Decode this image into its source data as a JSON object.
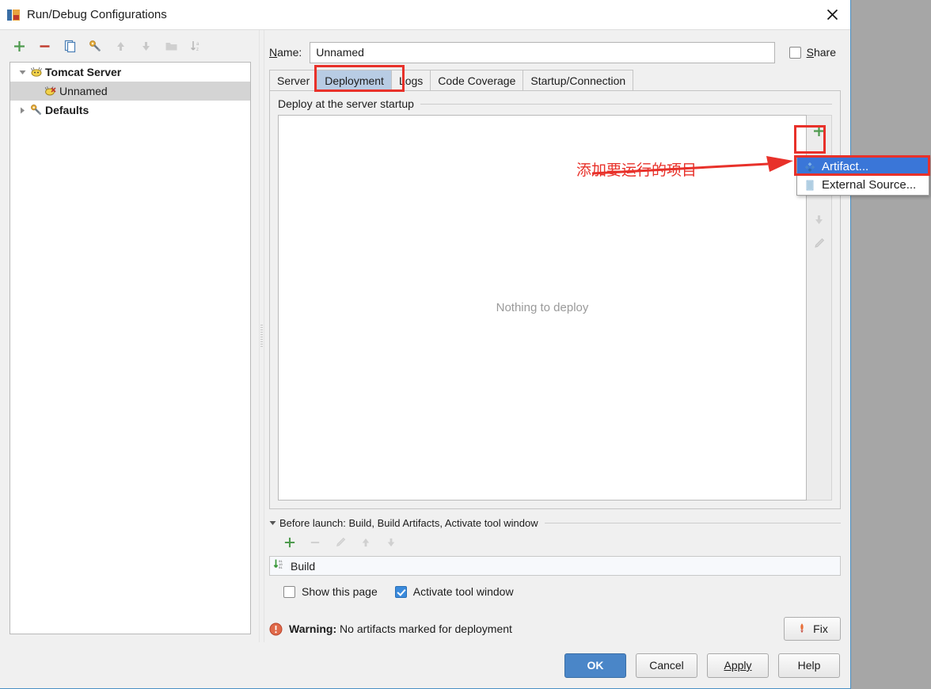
{
  "window": {
    "title": "Run/Debug Configurations",
    "app_icon": "intellij-idea-icon",
    "close_icon": "close-icon"
  },
  "left_toolbar": {
    "buttons": [
      {
        "name": "add-configuration-button",
        "icon": "plus-icon",
        "enabled": true
      },
      {
        "name": "remove-configuration-button",
        "icon": "minus-icon",
        "enabled": true
      },
      {
        "name": "copy-configuration-button",
        "icon": "copy-icon",
        "enabled": true
      },
      {
        "name": "edit-defaults-button",
        "icon": "wrench-icon",
        "enabled": true
      },
      {
        "name": "move-up-button",
        "icon": "arrow-up-icon",
        "enabled": false
      },
      {
        "name": "move-down-button",
        "icon": "arrow-down-icon",
        "enabled": false
      },
      {
        "name": "new-folder-button",
        "icon": "folder-icon",
        "enabled": false
      },
      {
        "name": "sort-alphabetically-button",
        "icon": "sort-az-icon",
        "enabled": false
      }
    ]
  },
  "tree": {
    "items": [
      {
        "label": "Tomcat Server",
        "icon": "tomcat-icon",
        "twisty": "expanded",
        "bold": true,
        "selected": false,
        "child": false
      },
      {
        "label": "Unnamed",
        "icon": "tomcat-run-icon",
        "twisty": "none",
        "bold": false,
        "selected": true,
        "child": true
      },
      {
        "label": "Defaults",
        "icon": "wrench-icon",
        "twisty": "collapsed",
        "bold": true,
        "selected": false,
        "child": false
      }
    ]
  },
  "name_field": {
    "label_prefix": "",
    "label": "Name:",
    "label_mnemonic": "N",
    "value": "Unnamed",
    "placeholder": "Unnamed"
  },
  "share": {
    "label": "Share",
    "mnemonic": "S",
    "checked": false
  },
  "tabs": [
    {
      "label": "Server",
      "selected": false
    },
    {
      "label": "Deployment",
      "selected": true
    },
    {
      "label": "Logs",
      "selected": false
    },
    {
      "label": "Code Coverage",
      "selected": false
    },
    {
      "label": "Startup/Connection",
      "selected": false
    }
  ],
  "deployment": {
    "group_title": "Deploy at the server startup",
    "empty_text": "Nothing to deploy",
    "toolbar": [
      {
        "name": "add-deployment-button",
        "icon": "plus-icon",
        "enabled": true
      },
      {
        "name": "move-down-deployment-button",
        "icon": "arrow-down-icon",
        "enabled": false
      },
      {
        "name": "edit-deployment-button",
        "icon": "pencil-icon",
        "enabled": false
      }
    ]
  },
  "dropdown": {
    "items": [
      {
        "label": "Artifact...",
        "icon": "artifact-icon",
        "selected": true
      },
      {
        "label": "External Source...",
        "icon": "external-source-icon",
        "selected": false
      }
    ]
  },
  "annotation": {
    "text": "添加要运行的项目",
    "color": "#e8312a",
    "arrow": "right-arrow-annotation"
  },
  "before_launch": {
    "title": "Before launch: Build, Build Artifacts, Activate tool window",
    "title_mnemonic": "B",
    "toolbar": [
      {
        "name": "add-task-button",
        "icon": "plus-icon",
        "enabled": true
      },
      {
        "name": "remove-task-button",
        "icon": "minus-icon",
        "enabled": false
      },
      {
        "name": "edit-task-button",
        "icon": "pencil-icon",
        "enabled": false
      },
      {
        "name": "task-move-up-button",
        "icon": "arrow-up-icon",
        "enabled": false
      },
      {
        "name": "task-move-down-button",
        "icon": "arrow-down-icon",
        "enabled": false
      }
    ],
    "tasks": [
      {
        "label": "Build",
        "icon": "build-icon"
      }
    ],
    "checkboxes": [
      {
        "label": "Show this page",
        "checked": false
      },
      {
        "label": "Activate tool window",
        "checked": true
      }
    ]
  },
  "warning": {
    "icon": "warning-icon",
    "prefix": "Warning:",
    "message": "No artifacts marked for deployment",
    "fix_button": {
      "label": "Fix",
      "icon": "warning-icon"
    }
  },
  "footer_buttons": [
    {
      "label": "OK",
      "primary": true,
      "mnemonic": ""
    },
    {
      "label": "Cancel",
      "primary": false,
      "mnemonic": ""
    },
    {
      "label": "Apply",
      "primary": false,
      "mnemonic": "A"
    },
    {
      "label": "Help",
      "primary": false,
      "mnemonic": ""
    }
  ],
  "colors": {
    "accent": "#4a86c8",
    "selection": "#3a76d8",
    "annotation": "#e8312a",
    "tab_selected": "#b8cce4",
    "window_bg": "#f0f0f0",
    "desktop_bg": "#a6a6a6"
  }
}
